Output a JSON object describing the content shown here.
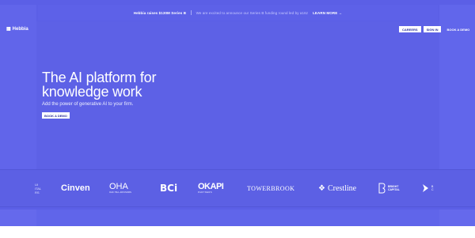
{
  "announcement": {
    "bold": "Hebbia raises $130M Series B",
    "text": "We are excited to announce our Series B funding round led by a16z",
    "link": "LEARN MORE →"
  },
  "header": {
    "logo_icon": "grid-logo-icon",
    "logo_text": "Hebbia",
    "careers": "CAREERS",
    "sign_in": "SIGN IN",
    "book_demo": "BOOK A DEMO"
  },
  "hero": {
    "headline_line1": "The AI platform for",
    "headline_line2": "knowledge work",
    "subtitle": "Add the power of generative AI to your firm.",
    "cta": "BOOK A DEMO"
  },
  "logos": {
    "cut_left": [
      "UI",
      "ITAL",
      "RS"
    ],
    "cinven": "Cinven",
    "oha": {
      "big": "OHA",
      "small": "OAK HILL ADVISORS"
    },
    "bci": "BCi",
    "okapi": {
      "big": "OKAPI",
      "small": "PARTNERS"
    },
    "towerbrook": "TOWERBROOK",
    "crestline": "Crestline",
    "bright": {
      "line1": "BRIGHT",
      "line2": "CAPITAL"
    },
    "cut_right": [
      "B",
      "C"
    ]
  },
  "colors": {
    "brand": "#5b5fe6",
    "text": "#ffffff",
    "button_text": "#2b2f9a"
  }
}
